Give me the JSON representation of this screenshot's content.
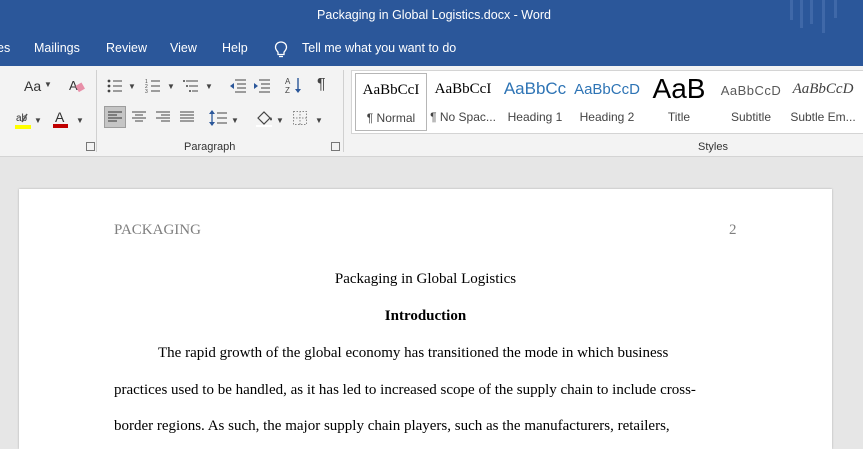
{
  "window": {
    "title": "Packaging in Global Logistics.docx  -  Word"
  },
  "menu": {
    "tabs": [
      "es",
      "Mailings",
      "Review",
      "View",
      "Help"
    ],
    "tell_me": "Tell me what you want to do"
  },
  "ribbon": {
    "paragraph_label": "Paragraph",
    "styles_label": "Styles",
    "font_size_button": "Aa",
    "pilcrow": "¶",
    "styles": [
      {
        "preview": "AaBbCcI",
        "name": "¶ Normal"
      },
      {
        "preview": "AaBbCcI",
        "name": "¶ No Spac..."
      },
      {
        "preview": "AaBbCc",
        "name": "Heading 1"
      },
      {
        "preview": "AaBbCcD",
        "name": "Heading 2"
      },
      {
        "preview": "AaB",
        "name": "Title"
      },
      {
        "preview": "AaBbCcD",
        "name": "Subtitle"
      },
      {
        "preview": "AaBbCcD",
        "name": "Subtle Em..."
      }
    ]
  },
  "colors": {
    "accent": "#2b579a",
    "highlight": "#ffff00",
    "font_color": "#c00000"
  },
  "document": {
    "header": "PACKAGING",
    "page_number": "2",
    "title": "Packaging in Global Logistics",
    "heading": "Introduction",
    "lines": [
      "The rapid growth of the global economy has transitioned the mode in which business",
      "practices used to be handled, as it has led to increased scope of the supply chain to include cross-",
      "border regions. As such, the major supply chain players, such as the manufacturers, retailers,"
    ]
  }
}
